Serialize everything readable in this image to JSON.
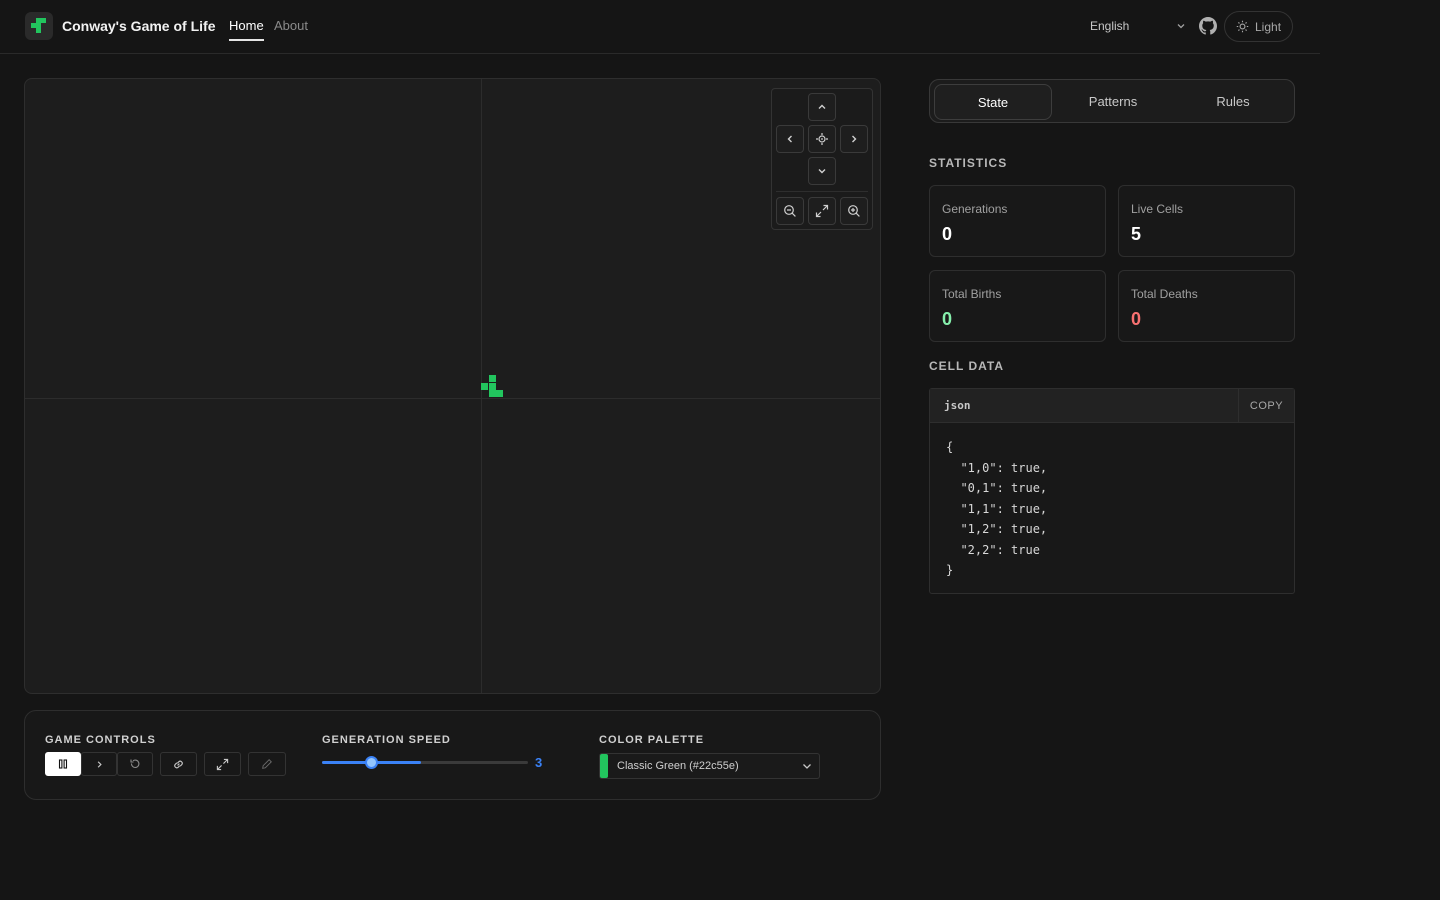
{
  "header": {
    "app_title": "Conway's Game of Life",
    "nav": {
      "home": "Home",
      "about": "About"
    },
    "language": "English",
    "theme_label": "Light"
  },
  "canvas": {
    "live_cell_color": "#22c55e"
  },
  "controls": {
    "game_controls_label": "GAME CONTROLS",
    "speed_label": "GENERATION SPEED",
    "speed_value": "3",
    "speed_fraction": 0.48,
    "palette_label": "COLOR PALETTE",
    "palette_value": "Classic Green (#22c55e)",
    "palette_swatch": "#22c55e"
  },
  "panel": {
    "tabs": [
      "State",
      "Patterns",
      "Rules"
    ],
    "statistics_label": "STATISTICS",
    "stats": {
      "generations": {
        "label": "Generations",
        "value": "0"
      },
      "live_cells": {
        "label": "Live Cells",
        "value": "5"
      },
      "births": {
        "label": "Total Births",
        "value": "0"
      },
      "deaths": {
        "label": "Total Deaths",
        "value": "0"
      }
    },
    "cell_data_label": "CELL DATA",
    "code_lang": "json",
    "copy_label": "COPY",
    "code": "{\n  \"1,0\": true,\n  \"0,1\": true,\n  \"1,1\": true,\n  \"1,2\": true,\n  \"2,2\": true\n}"
  },
  "colors": {
    "accent": "#3b82f6",
    "births": "#86efac",
    "deaths": "#f87171"
  },
  "cells": [
    [
      1,
      0
    ],
    [
      0,
      1
    ],
    [
      1,
      1
    ],
    [
      1,
      2
    ],
    [
      2,
      2
    ]
  ]
}
